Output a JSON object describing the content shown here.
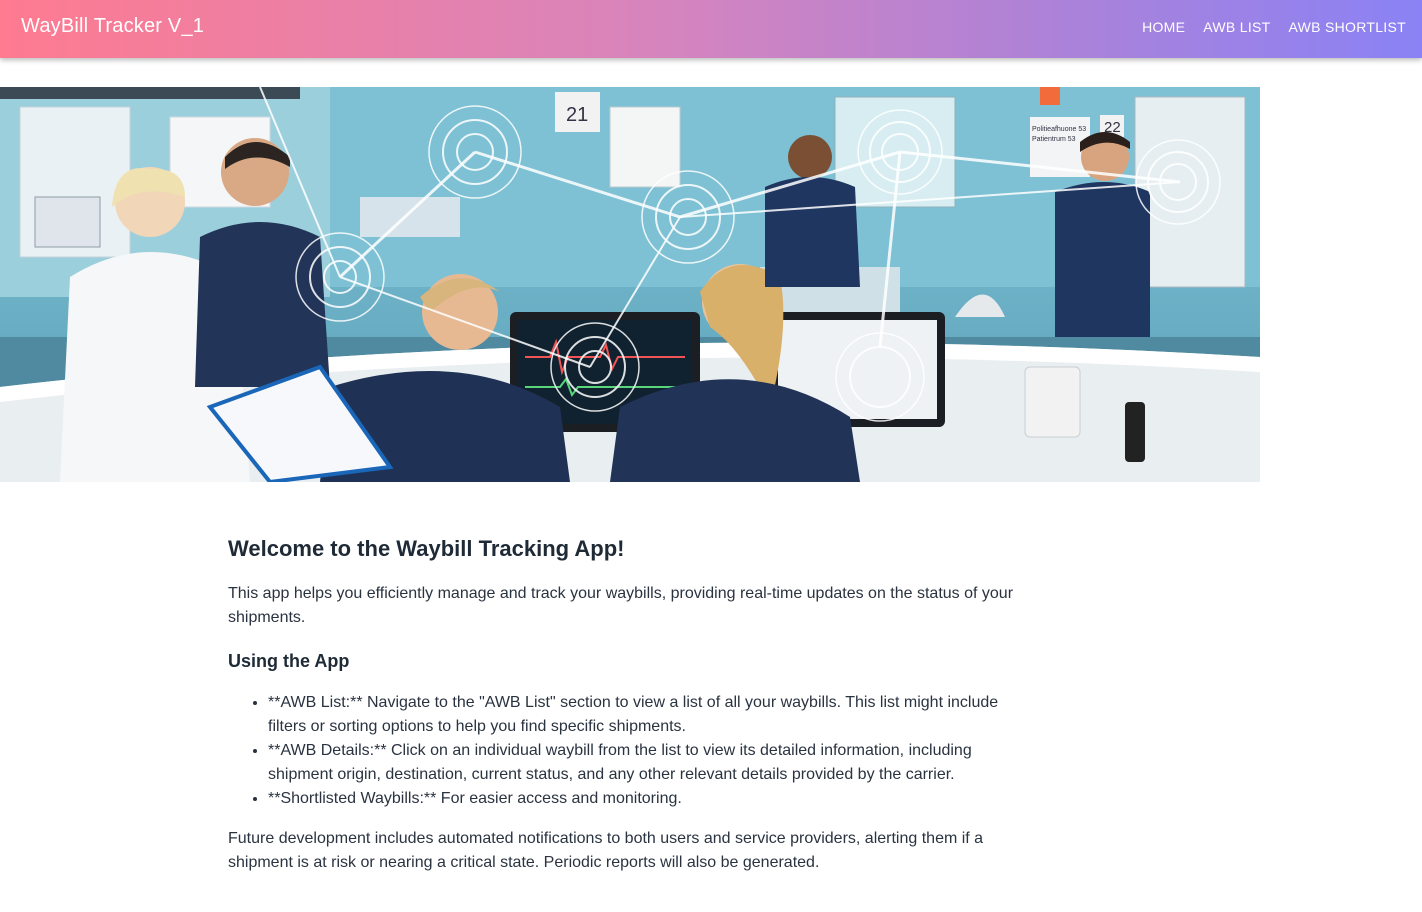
{
  "app": {
    "title": "WayBill Tracker V_1"
  },
  "nav": {
    "items": [
      {
        "label": "HOME"
      },
      {
        "label": "AWB LIST"
      },
      {
        "label": "AWB SHORTLIST"
      }
    ]
  },
  "hero": {
    "description": "hospital-ward-photo",
    "room_number": "21",
    "room_number_2": "22",
    "sign_line_1": "Politieafhuone 53",
    "sign_line_2": "Patientrum 53"
  },
  "main": {
    "heading": "Welcome to the Waybill Tracking App!",
    "intro": "This app helps you efficiently manage and track your waybills, providing real-time updates on the status of your shipments.",
    "subheading": "Using the App",
    "list": [
      "**AWB List:** Navigate to the \"AWB List\" section to view a list of all your waybills. This list might include filters or sorting options to help you find specific shipments.",
      "**AWB Details:** Click on an individual waybill from the list to view its detailed information, including shipment origin, destination, current status, and any other relevant details provided by the carrier.",
      "**Shortlisted Waybills:** For easier access and monitoring."
    ],
    "outro": "Future development includes automated notifications to both users and service providers, alerting them if a shipment is at risk or nearing a critical state. Periodic reports will also be generated."
  },
  "colors": {
    "header_gradient_start": "#fe7b90",
    "header_gradient_end": "#8a82f5",
    "text": "#2a3340"
  }
}
